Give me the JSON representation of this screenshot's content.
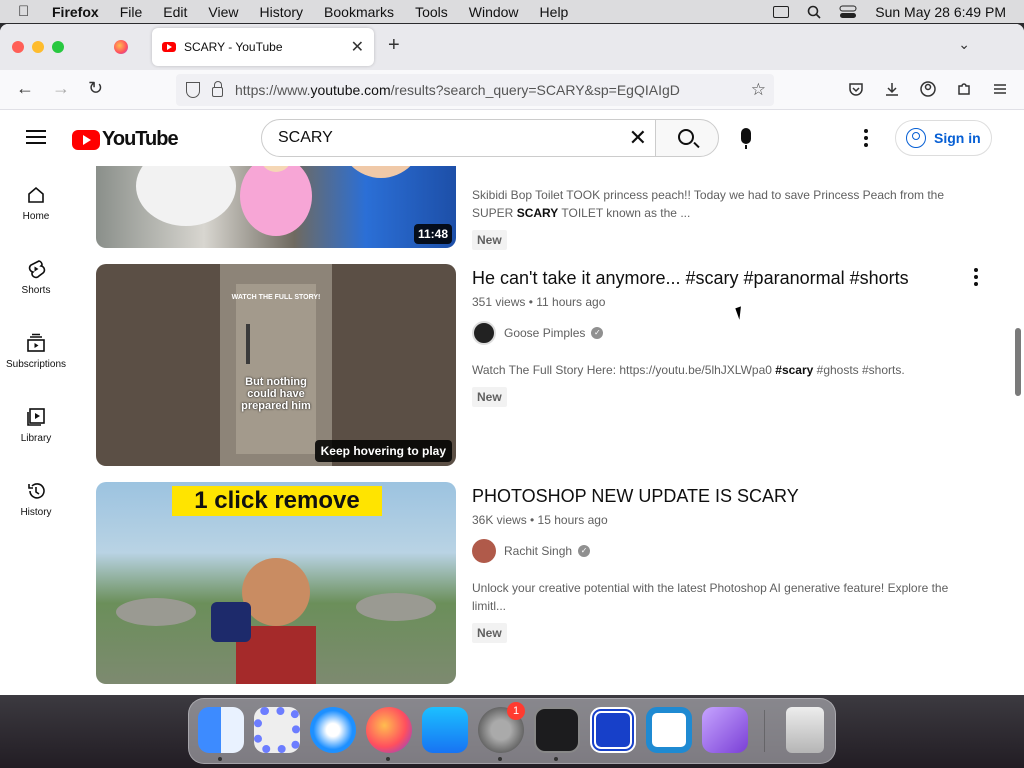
{
  "menubar": {
    "app": "Firefox",
    "items": [
      "File",
      "Edit",
      "View",
      "History",
      "Bookmarks",
      "Tools",
      "Window",
      "Help"
    ],
    "clock": "Sun May 28  6:49 PM"
  },
  "browser": {
    "tab_title": "SCARY - YouTube",
    "url_prefix": "https://www.",
    "url_domain": "youtube.com",
    "url_rest": "/results?search_query=SCARY&sp=EgQIAIgD"
  },
  "youtube": {
    "logo_text": "YouTube",
    "search_query": "SCARY",
    "signin_label": "Sign in",
    "sidebar": [
      {
        "label": "Home",
        "icon": "home-icon"
      },
      {
        "label": "Shorts",
        "icon": "shorts-icon"
      },
      {
        "label": "Subscriptions",
        "icon": "subscriptions-icon"
      },
      {
        "label": "Library",
        "icon": "library-icon"
      },
      {
        "label": "History",
        "icon": "history-icon"
      }
    ],
    "videos": [
      {
        "title": "",
        "stats": "",
        "channel": "",
        "description_parts": [
          "Skibidi Bop Toilet TOOK princess peach!! Today we had to save Princess Peach from the SUPER ",
          "SCARY",
          " TOILET known as the ..."
        ],
        "badge": "New",
        "duration": "11:48"
      },
      {
        "title": "He can't take it anymore... #scary #paranormal #shorts",
        "stats": "351 views • 11 hours ago",
        "channel": "Goose Pimples",
        "description_parts": [
          "Watch The Full Story Here: https://youtu.be/5lhJXLWpa0 ",
          "#scary",
          " #ghosts #shorts."
        ],
        "badge": "New",
        "overlay": "Keep hovering to play",
        "thumb_text": "But nothing could have prepared him",
        "thumb_small_text": "WATCH THE FULL STORY!"
      },
      {
        "title": "PHOTOSHOP NEW UPDATE IS SCARY",
        "stats": "36K views • 15 hours ago",
        "channel": "Rachit Singh",
        "description_parts": [
          "Unlock your creative potential with the latest Photoshop AI generative feature! Explore the limitl...",
          "",
          ""
        ],
        "badge": "New",
        "thumb_banner": "1 click remove"
      }
    ]
  },
  "dock": {
    "notification_count": "1",
    "apps": [
      "finder-icon",
      "launchpad-icon",
      "safari-icon",
      "firefox-icon",
      "app-store-icon",
      "system-settings-icon",
      "terminal-icon",
      "screen-capture-icon",
      "vscode-icon",
      "visual-studio-icon",
      "trash-icon"
    ]
  },
  "colors": {
    "youtube_red": "#ff0000",
    "link_blue": "#065fd4",
    "muted_text": "#606060"
  }
}
